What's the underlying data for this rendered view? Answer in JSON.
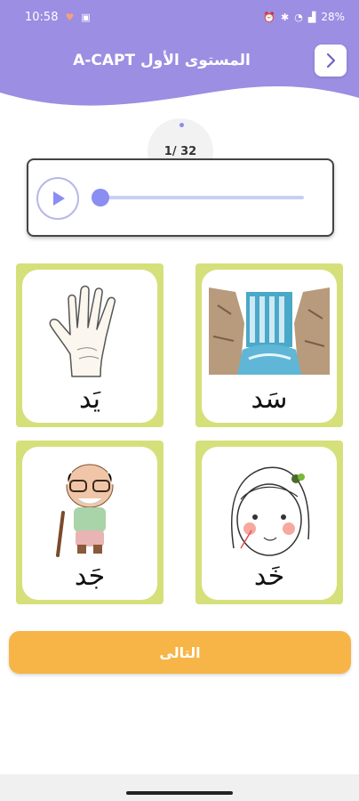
{
  "status": {
    "time": "10:58",
    "battery": "28%",
    "left_icons": [
      "heart-icon",
      "image-icon"
    ],
    "right_icons": [
      "alarm-icon",
      "bluetooth-icon",
      "wifi-icon",
      "signal-icon",
      "battery-icon"
    ]
  },
  "header": {
    "title": "المستوى الأول A-CAPT",
    "back_icon": "chevron-right-icon",
    "color": "#9b8ee3"
  },
  "counter": {
    "text": "1/ 32"
  },
  "player": {
    "play_icon": "play-icon",
    "progress": 0.0,
    "accent": "#8a8df2"
  },
  "cards": [
    {
      "word": "سَد",
      "image": "dam-waterfall-image"
    },
    {
      "word": "يَد",
      "image": "hand-image"
    },
    {
      "word": "خَد",
      "image": "girl-face-image"
    },
    {
      "word": "جَد",
      "image": "grandfather-image"
    }
  ],
  "next_button": {
    "label": "التالى",
    "color": "#f7b547"
  },
  "colors": {
    "card_border": "#d5e07b"
  }
}
